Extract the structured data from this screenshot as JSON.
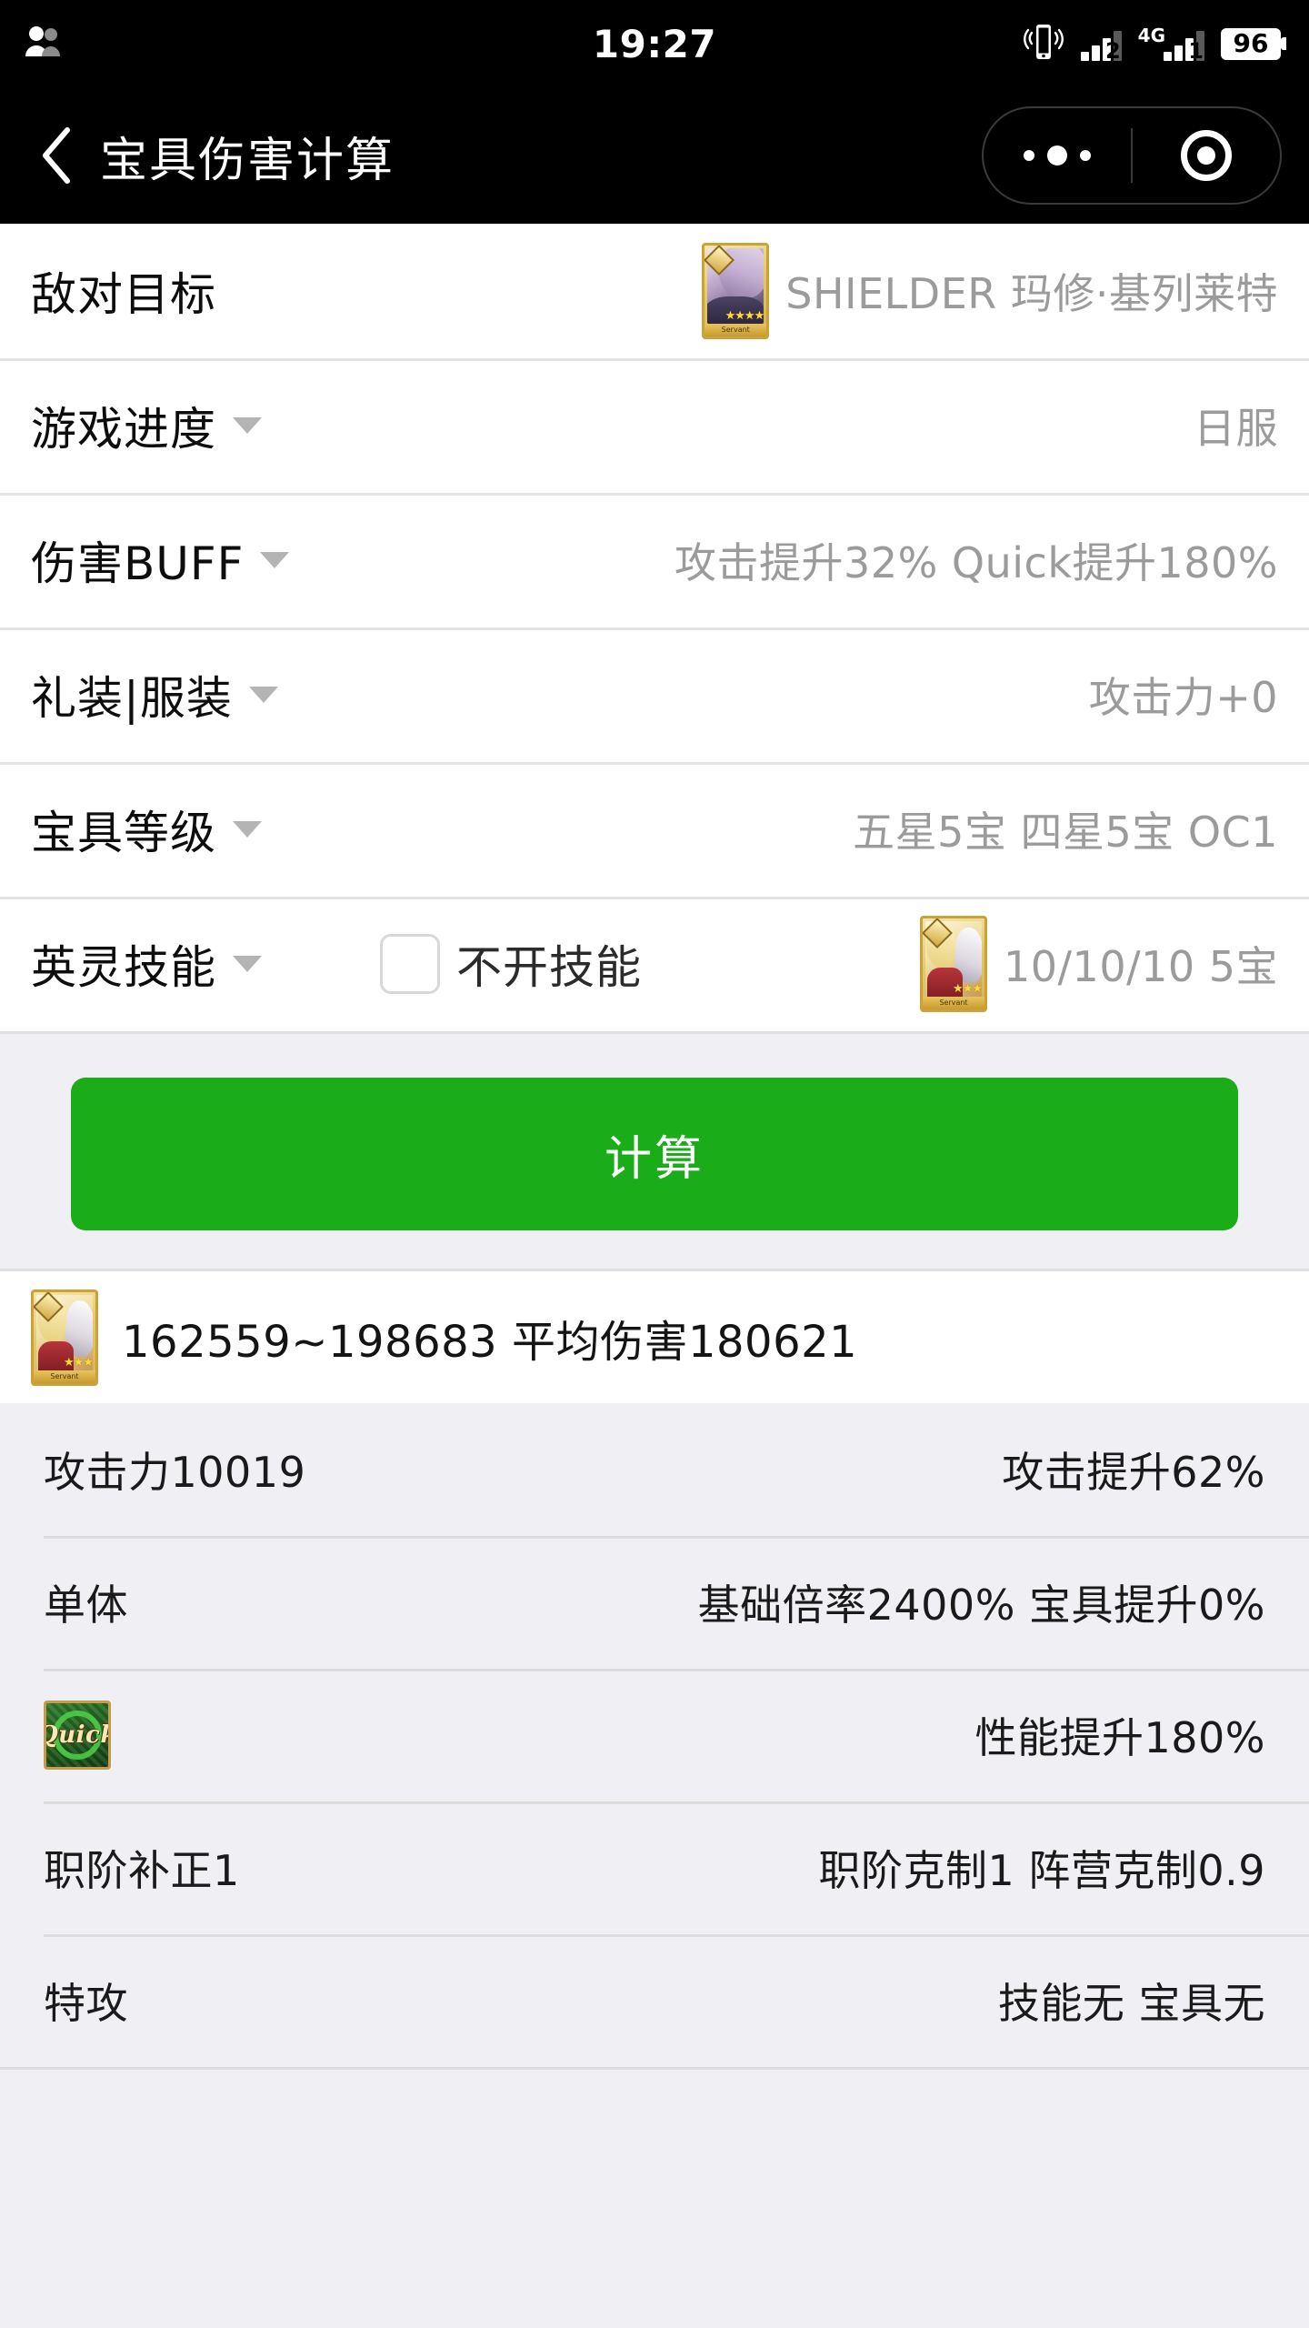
{
  "status_bar": {
    "time": "19:27",
    "contacts_icon": "people-icon",
    "vibrate_icon": "vibrate-icon",
    "sim1_signal_label": "2",
    "sim2_network_label": "4G",
    "sim2_signal_label": "1",
    "battery_percent": "96"
  },
  "nav": {
    "back_icon": "back-chevron-icon",
    "title": "宝具伤害计算",
    "menu_icon": "more-dots-icon",
    "close_icon": "target-circle-icon"
  },
  "form": {
    "rows": [
      {
        "label": "敌对目标",
        "has_caret": false,
        "icon": "servant-card-mash",
        "value": "SHIELDER 玛修·基列莱特"
      },
      {
        "label": "游戏进度",
        "has_caret": true,
        "icon": null,
        "value": "日服"
      },
      {
        "label": "伤害BUFF",
        "has_caret": true,
        "icon": null,
        "value": "攻击提升32% Quick提升180%"
      },
      {
        "label": "礼装|服装",
        "has_caret": true,
        "icon": null,
        "value": "攻击力+0"
      },
      {
        "label": "宝具等级",
        "has_caret": true,
        "icon": null,
        "value": "五星5宝 四星5宝 OC1"
      },
      {
        "label": "英灵技能",
        "has_caret": true,
        "icon": "servant-card-duo",
        "value": "10/10/10 5宝",
        "checkbox": {
          "label": "不开技能",
          "checked": false
        }
      }
    ]
  },
  "calculate": {
    "label": "计算",
    "color": "#1aad19"
  },
  "result": {
    "icon": "servant-card-duo",
    "summary": "162559~198683 平均伤害180621",
    "rows": [
      {
        "left": "攻击力10019",
        "right": "攻击提升62%",
        "left_icon": null
      },
      {
        "left": "单体",
        "right": "基础倍率2400% 宝具提升0%",
        "left_icon": null
      },
      {
        "left": "",
        "right": "性能提升180%",
        "left_icon": "quick-card-icon",
        "left_icon_text": "Quick"
      },
      {
        "left": "职阶补正1",
        "right": "职阶克制1 阵营克制0.9",
        "left_icon": null
      },
      {
        "left": "特攻",
        "right": "技能无 宝具无",
        "left_icon": null
      }
    ]
  },
  "card_labels": {
    "servant_footer": "Servant",
    "stars": "★★★★",
    "stars_duo": "★★★"
  }
}
